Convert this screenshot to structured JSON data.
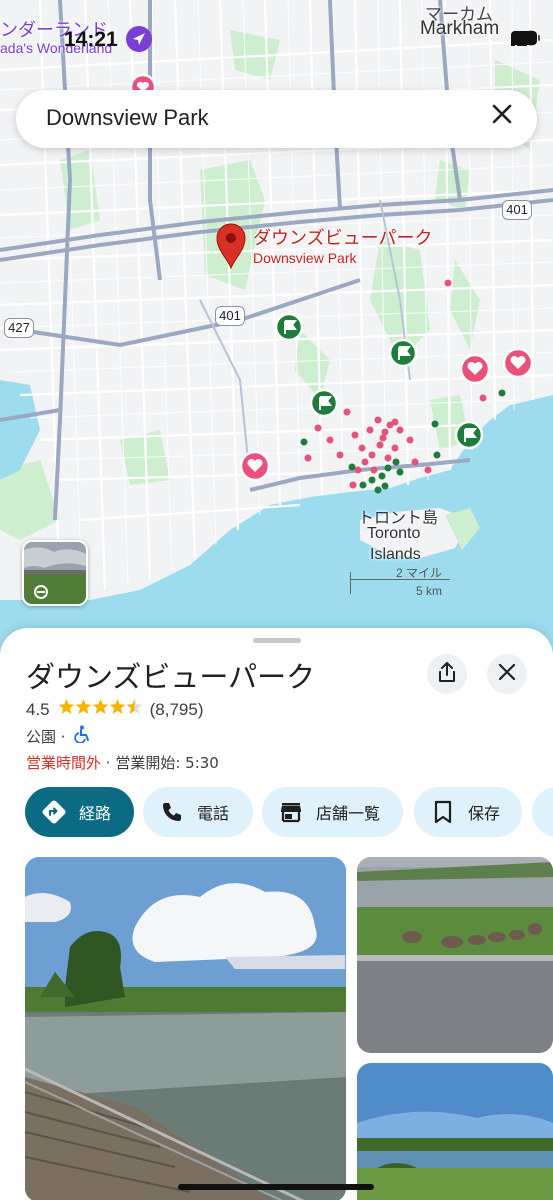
{
  "status": {
    "time": "14:21"
  },
  "map": {
    "labels": {
      "top_left_jp": "ンダーランド",
      "top_left_en": "ada's Wonderland",
      "top_right_jp": "マーカム",
      "top_right_en": "Markham",
      "hwy_401_a": "401",
      "hwy_401_b": "401",
      "hwy_427": "427",
      "islands_jp": "トロント島",
      "islands_en_1": "Toronto",
      "islands_en_2": "Islands",
      "scale_mi": "2 マイル",
      "scale_km": "5 km"
    },
    "pin": {
      "name_jp": "ダウンズビューパーク",
      "name_en": "Downsview Park"
    },
    "colors": {
      "water": "#9cdcee",
      "green": "#cdeecf",
      "road": "#ffffff",
      "highway": "#9aa8c4",
      "pin": "#d93025",
      "pink": "#e8527a",
      "dark_green": "#1e7d3a"
    }
  },
  "search": {
    "query": "Downsview Park"
  },
  "sheet": {
    "title": "ダウンズビューパーク",
    "rating": "4.5",
    "stars": "★★★★⯪",
    "reviews": "(8,795)",
    "category": "公園 ·",
    "status_closed": "営業時間外",
    "status_sep": " · ",
    "opens": "営業開始: 5:30",
    "actions": [
      {
        "label": "経路",
        "icon": "directions-icon"
      },
      {
        "label": "電話",
        "icon": "phone-icon"
      },
      {
        "label": "店舗一覧",
        "icon": "store-icon"
      },
      {
        "label": "保存",
        "icon": "bookmark-icon"
      }
    ]
  }
}
